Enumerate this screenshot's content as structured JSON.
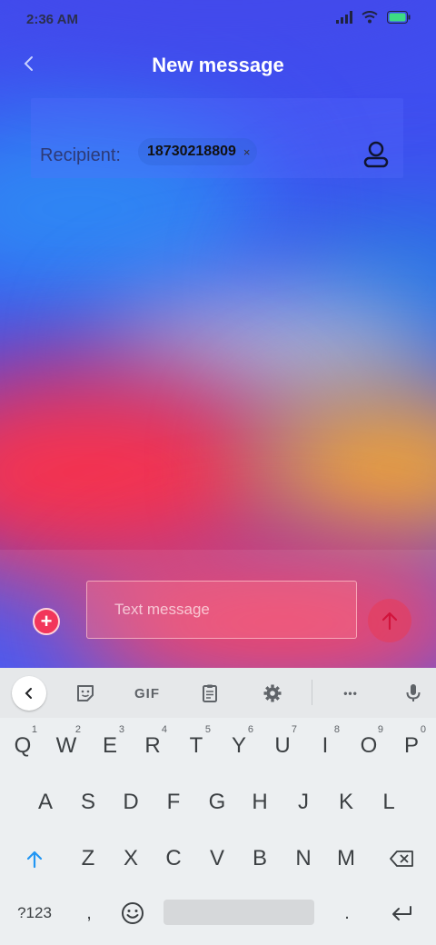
{
  "status_bar": {
    "time": "2:36 AM",
    "battery_color": "#3ddc84"
  },
  "header": {
    "title": "New message",
    "back_icon": "chevron-left-icon"
  },
  "recipient": {
    "label": "Recipient:",
    "chip_value": "18730218809",
    "chip_remove": "×",
    "contact_icon": "person-icon"
  },
  "composer": {
    "placeholder": "Text message",
    "attach_symbol": "+",
    "send_icon": "arrow-up-icon"
  },
  "keyboard": {
    "toolbar": {
      "gif_label": "GIF",
      "more_label": "•••"
    },
    "row1": [
      {
        "k": "Q",
        "h": "1"
      },
      {
        "k": "W",
        "h": "2"
      },
      {
        "k": "E",
        "h": "3"
      },
      {
        "k": "R",
        "h": "4"
      },
      {
        "k": "T",
        "h": "5"
      },
      {
        "k": "Y",
        "h": "6"
      },
      {
        "k": "U",
        "h": "7"
      },
      {
        "k": "I",
        "h": "8"
      },
      {
        "k": "O",
        "h": "9"
      },
      {
        "k": "P",
        "h": "0"
      }
    ],
    "row2": [
      "A",
      "S",
      "D",
      "F",
      "G",
      "H",
      "J",
      "K",
      "L"
    ],
    "row3": [
      "Z",
      "X",
      "C",
      "V",
      "B",
      "N",
      "M"
    ],
    "row4": {
      "symbols_label": "?123",
      "comma": ",",
      "period": "."
    }
  },
  "colors": {
    "accent_blue": "#2196f3",
    "gradient_red": "#f5334f",
    "gradient_orange": "#f7a630"
  }
}
